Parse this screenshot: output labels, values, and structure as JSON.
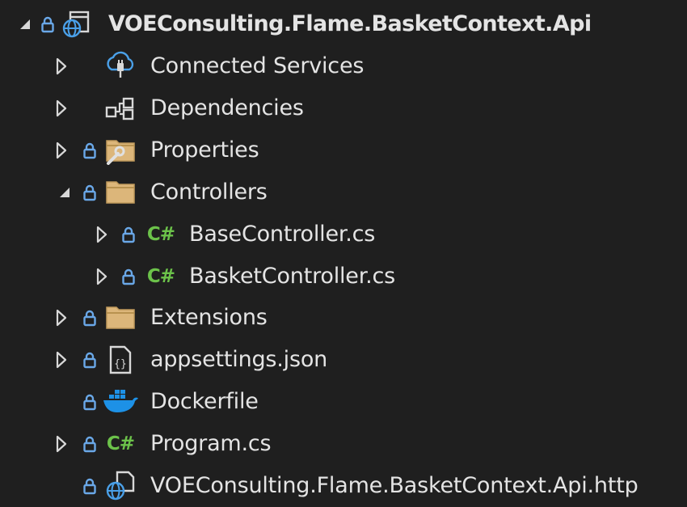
{
  "project": {
    "name": "VOEConsulting.Flame.BasketContext.Api",
    "expanded": true
  },
  "items": [
    {
      "label": "Connected Services",
      "icon": "connected-services-icon",
      "expandable": true,
      "expanded": false,
      "locked": false
    },
    {
      "label": "Dependencies",
      "icon": "dependencies-icon",
      "expandable": true,
      "expanded": false,
      "locked": false
    },
    {
      "label": "Properties",
      "icon": "properties-folder-icon",
      "expandable": true,
      "expanded": false,
      "locked": true
    },
    {
      "label": "Controllers",
      "icon": "folder-icon",
      "expandable": true,
      "expanded": true,
      "locked": true,
      "children": [
        {
          "label": "BaseController.cs",
          "icon": "csharp-file-icon",
          "expandable": true,
          "expanded": false,
          "locked": true
        },
        {
          "label": "BasketController.cs",
          "icon": "csharp-file-icon",
          "expandable": true,
          "expanded": false,
          "locked": true
        }
      ]
    },
    {
      "label": "Extensions",
      "icon": "folder-icon",
      "expandable": true,
      "expanded": false,
      "locked": true
    },
    {
      "label": "appsettings.json",
      "icon": "json-file-icon",
      "expandable": true,
      "expanded": false,
      "locked": true
    },
    {
      "label": "Dockerfile",
      "icon": "docker-icon",
      "expandable": false,
      "locked": true
    },
    {
      "label": "Program.cs",
      "icon": "csharp-file-icon",
      "expandable": true,
      "expanded": false,
      "locked": true
    },
    {
      "label": "VOEConsulting.Flame.BasketContext.Api.http",
      "icon": "http-file-icon",
      "expandable": false,
      "locked": true
    }
  ],
  "colors": {
    "background": "#1f1f1f",
    "text": "#e4e4e4",
    "lock": "#6aa8e8",
    "folder": "#dcb67a",
    "csharp": "#6cc24a",
    "docker": "#1d91e6"
  }
}
